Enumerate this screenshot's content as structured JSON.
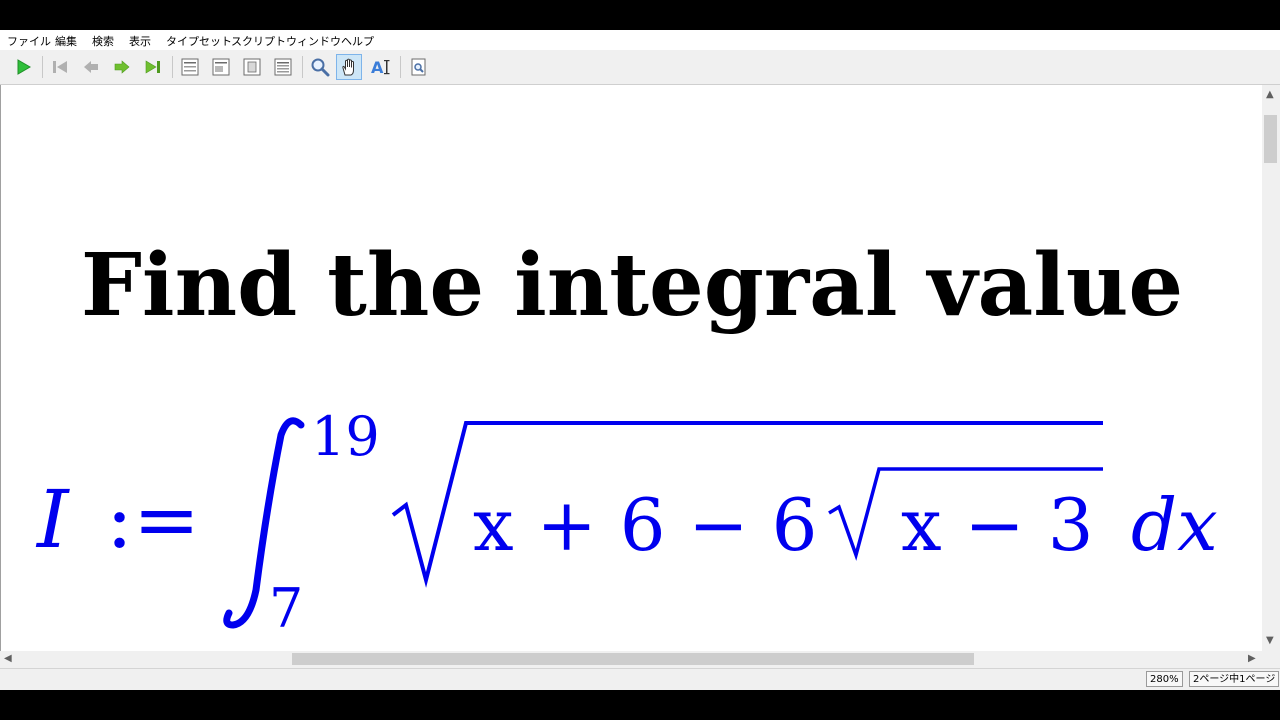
{
  "menu": {
    "items": [
      "ファイル",
      "編集",
      "検索",
      "表示",
      "タイプセット",
      "スクリプト",
      "ウィンドウ",
      "ヘルプ"
    ]
  },
  "toolbar": {
    "buttons": [
      "play-icon",
      "first-page-icon",
      "previous-page-icon",
      "next-page-icon",
      "last-page-icon",
      "single-page-icon",
      "continuous-page-icon",
      "facing-pages-icon",
      "continuous-facing-icon",
      "magnifier-icon",
      "hand-tool-icon",
      "text-select-icon",
      "find-in-page-icon"
    ],
    "active": "hand-tool-icon"
  },
  "document": {
    "title": "Find the integral value",
    "formula": {
      "lhs": "I",
      "assign": ":=",
      "upper_limit": "19",
      "lower_limit": "7",
      "radicand_prefix": "x + 6 − 6",
      "inner_radicand": "x − 3",
      "differential": "dx",
      "color": "#0000ee"
    }
  },
  "status": {
    "zoom": "280%",
    "page": "2ページ中1ページ"
  },
  "colors": {
    "accent": "#3b7dd8",
    "play": "#2fbf3a",
    "nav": "#6fbf2f"
  }
}
